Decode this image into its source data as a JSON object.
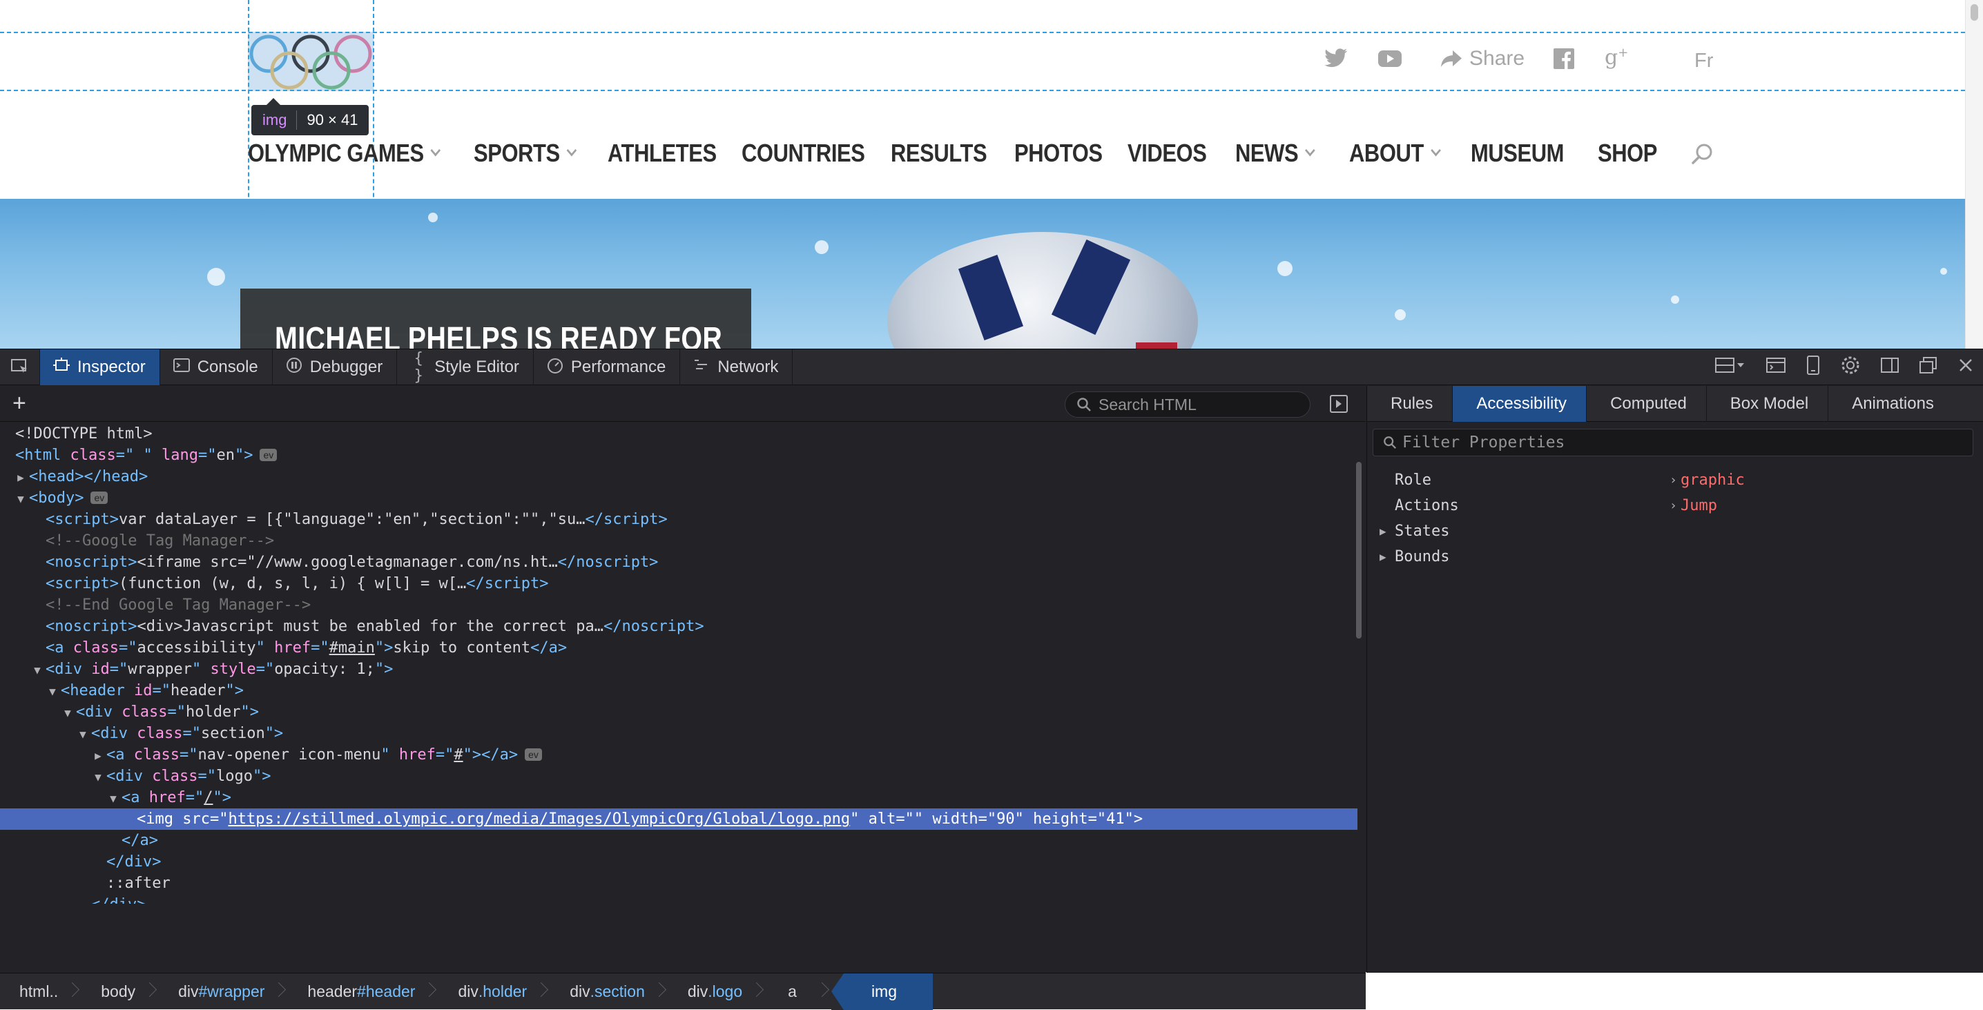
{
  "site": {
    "inspector_box": {
      "tag": "img",
      "dimensions": "90 × 41"
    },
    "top_links": {
      "share_label": "Share",
      "lang_label": "Fr"
    },
    "nav_items": [
      {
        "label": "OLYMPIC GAMES",
        "has_dropdown": true
      },
      {
        "label": "SPORTS",
        "has_dropdown": true
      },
      {
        "label": "ATHLETES",
        "has_dropdown": false
      },
      {
        "label": "COUNTRIES",
        "has_dropdown": false
      },
      {
        "label": "RESULTS",
        "has_dropdown": false
      },
      {
        "label": "PHOTOS",
        "has_dropdown": false
      },
      {
        "label": "VIDEOS",
        "has_dropdown": false
      },
      {
        "label": "NEWS",
        "has_dropdown": true
      },
      {
        "label": "ABOUT",
        "has_dropdown": true
      },
      {
        "label": "MUSEUM",
        "has_dropdown": false
      },
      {
        "label": "SHOP",
        "has_dropdown": false
      }
    ],
    "hero_headline": "MICHAEL PHELPS IS READY FOR",
    "ring_colors": [
      "#5ba6d8",
      "#c9b98a",
      "#39424a",
      "#6fb28f",
      "#c97fa8"
    ]
  },
  "devtools": {
    "toolbar_tabs": [
      {
        "label": "Inspector",
        "icon": "inspector-icon",
        "active": true
      },
      {
        "label": "Console",
        "icon": "console-icon",
        "active": false
      },
      {
        "label": "Debugger",
        "icon": "debugger-icon",
        "active": false
      },
      {
        "label": "Style Editor",
        "icon": "style-editor-icon",
        "active": false
      },
      {
        "label": "Performance",
        "icon": "performance-icon",
        "active": false
      },
      {
        "label": "Network",
        "icon": "network-icon",
        "active": false
      }
    ],
    "search_placeholder": "Search HTML",
    "breadcrumbs": [
      {
        "tag": "html..",
        "cls": ""
      },
      {
        "tag": "body",
        "cls": ""
      },
      {
        "tag": "div",
        "cls": "#wrapper"
      },
      {
        "tag": "header",
        "cls": "#header"
      },
      {
        "tag": "div",
        "cls": ".holder"
      },
      {
        "tag": "div",
        "cls": ".section"
      },
      {
        "tag": "div",
        "cls": ".logo"
      },
      {
        "tag": "a",
        "cls": ""
      },
      {
        "tag": "img",
        "cls": "",
        "active": true
      }
    ],
    "side_tabs": [
      {
        "label": "Rules",
        "active": false
      },
      {
        "label": "Accessibility",
        "active": true
      },
      {
        "label": "Computed",
        "active": false
      },
      {
        "label": "Box Model",
        "active": false
      },
      {
        "label": "Animations",
        "active": false
      }
    ],
    "filter_placeholder": "Filter Properties",
    "properties": [
      {
        "name": "Role",
        "value": "graphic",
        "expandable": false
      },
      {
        "name": "Actions",
        "value": "Jump",
        "expandable": false
      },
      {
        "name": "States",
        "value": "",
        "expandable": true
      },
      {
        "name": "Bounds",
        "value": "",
        "expandable": true
      }
    ],
    "accent_color": "#204e8a",
    "selected_row_color": "#4a69bd"
  }
}
